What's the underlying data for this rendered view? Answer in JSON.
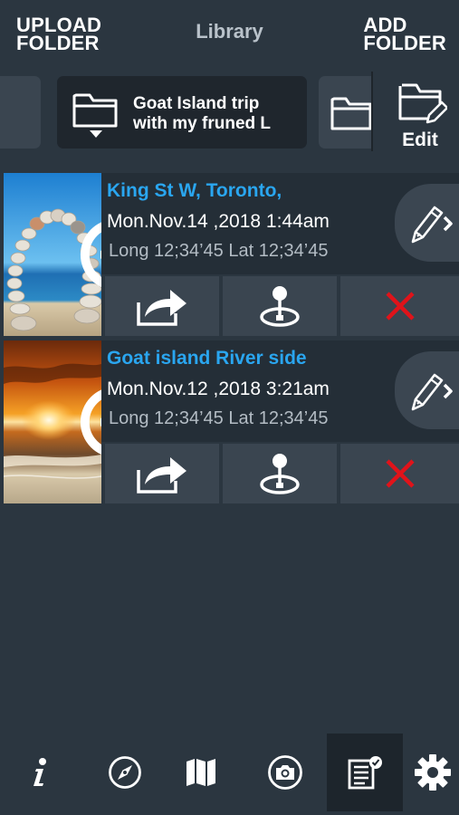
{
  "header": {
    "upload_folder_label": "UPLOAD\nFOLDER",
    "title": "Library",
    "add_folder_label": "ADD\nFOLDER"
  },
  "folder_strip": {
    "selected_folder_name": "Goat Island trip\nwith my fruned L",
    "edit_label": "Edit"
  },
  "items": [
    {
      "title": "King St W, Toronto,",
      "date": "Mon.Nov.14 ,2018  1:44am",
      "coords": "Long 12;34’45  Lat 12;34’45",
      "thumbnail": "beach-stone-arch"
    },
    {
      "title": "Goat island River side",
      "date": "Mon.Nov.12 ,2018  3:21am",
      "coords": "Long 12;34’45  Lat 12;34’45",
      "thumbnail": "sunset-beach"
    }
  ],
  "bottom_nav": {
    "items": [
      "info-icon",
      "compass-icon",
      "map-icon",
      "camera-icon",
      "library-icon",
      "settings-icon"
    ],
    "active": "library-icon"
  },
  "colors": {
    "background": "#2b3640",
    "title_accent": "#2aa6f0",
    "delete_red": "#e0131a",
    "tile": "#3a4550"
  }
}
